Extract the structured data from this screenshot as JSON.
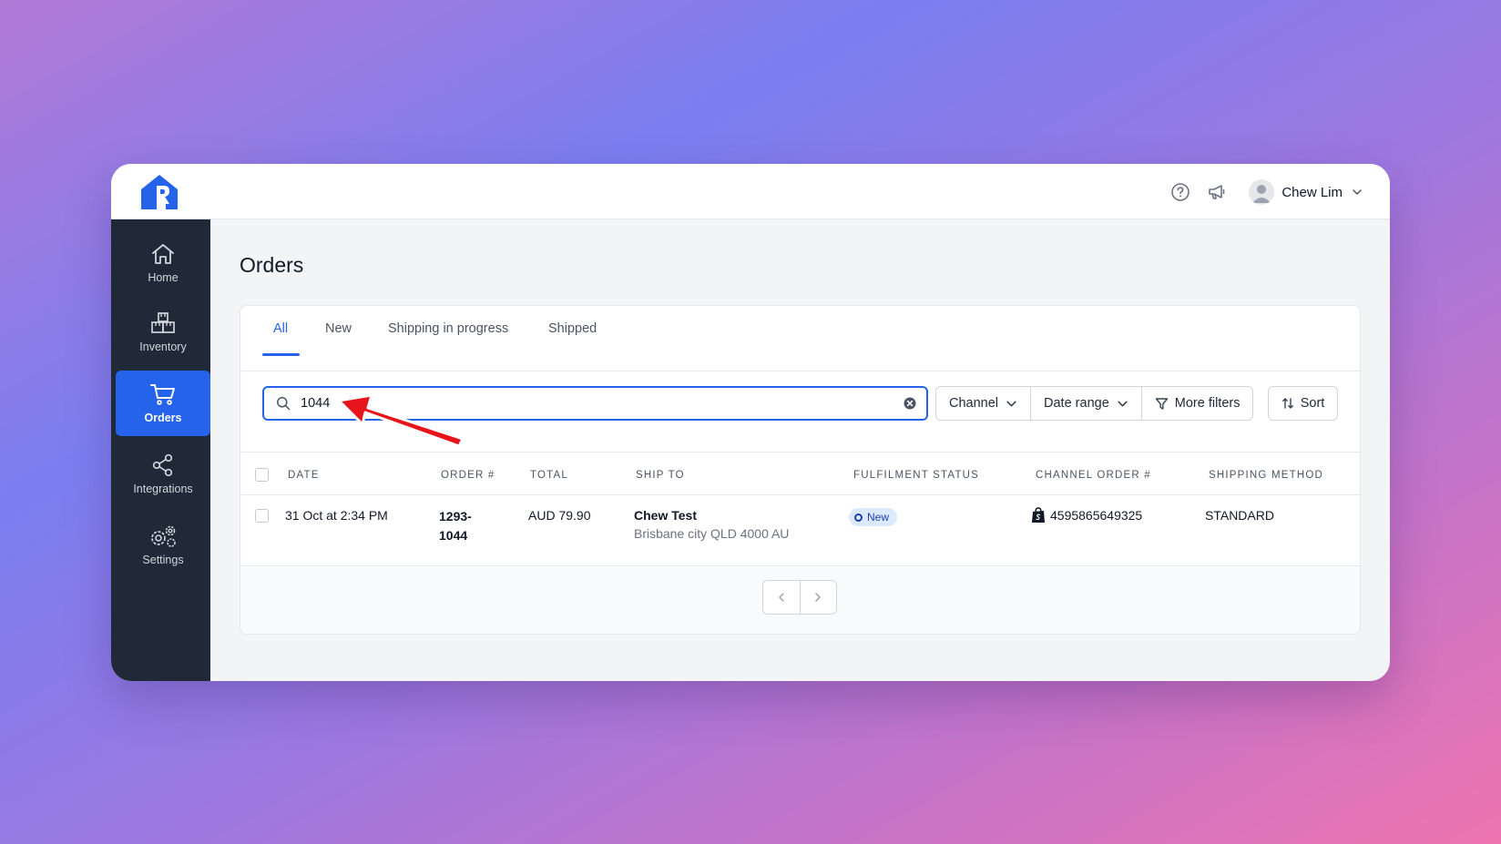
{
  "header": {
    "user_name": "Chew Lim"
  },
  "sidebar": {
    "items": [
      {
        "label": "Home",
        "icon": "home-icon"
      },
      {
        "label": "Inventory",
        "icon": "boxes-icon"
      },
      {
        "label": "Orders",
        "icon": "cart-icon",
        "active": true
      },
      {
        "label": "Integrations",
        "icon": "share-icon"
      },
      {
        "label": "Settings",
        "icon": "gears-icon"
      }
    ]
  },
  "page": {
    "title": "Orders"
  },
  "tabs": [
    {
      "label": "All",
      "active": true
    },
    {
      "label": "New"
    },
    {
      "label": "Shipping in progress"
    },
    {
      "label": "Shipped"
    }
  ],
  "search": {
    "value": "1044"
  },
  "filters": {
    "channel": "Channel",
    "date_range": "Date range",
    "more": "More filters",
    "sort": "Sort"
  },
  "table": {
    "columns": [
      "DATE",
      "ORDER #",
      "TOTAL",
      "SHIP TO",
      "FULFILMENT STATUS",
      "CHANNEL ORDER #",
      "SHIPPING METHOD"
    ],
    "rows": [
      {
        "date": "31 Oct at 2:34 PM",
        "order_line1": "1293-",
        "order_line2": "1044",
        "total": "AUD 79.90",
        "ship_name": "Chew Test",
        "ship_address": "Brisbane city QLD 4000 AU",
        "status": "New",
        "channel_order": "4595865649325",
        "shipping_method": "STANDARD"
      }
    ]
  },
  "colors": {
    "accent": "#2563eb",
    "sidebar": "#1f2937",
    "annotation_arrow": "#e8141c"
  }
}
